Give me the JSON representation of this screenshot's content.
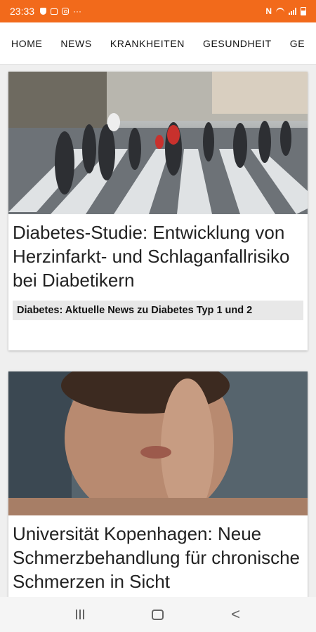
{
  "status_bar": {
    "time": "23:33",
    "left_icons": [
      "shield-icon",
      "image-icon",
      "instagram-icon",
      "more-icon"
    ],
    "right_icons": [
      "nfc-icon",
      "wifi-icon",
      "signal-icon",
      "battery-icon"
    ],
    "more_glyph": "···",
    "nfc_glyph": "N",
    "background": "#f26a1b"
  },
  "nav": {
    "tabs": [
      "HOME",
      "NEWS",
      "KRANKHEITEN",
      "GESUNDHEIT",
      "GE"
    ]
  },
  "articles": [
    {
      "headline": "Diabetes-Studie: Entwicklung von Herzinfarkt- und Schlaganfallrisiko bei Diabetikern",
      "tag": "Diabetes: Aktuelle News zu Diabetes Typ 1 und 2",
      "image": "crowd-crosswalk-photo"
    },
    {
      "headline": "Universität Kopenhagen: Neue Schmerzbehandlung für chronische Schmerzen in Sicht",
      "image": "person-hand-on-face-photo"
    }
  ],
  "system_nav": {
    "buttons": [
      "recent-apps",
      "home",
      "back"
    ],
    "back_glyph": "<"
  }
}
